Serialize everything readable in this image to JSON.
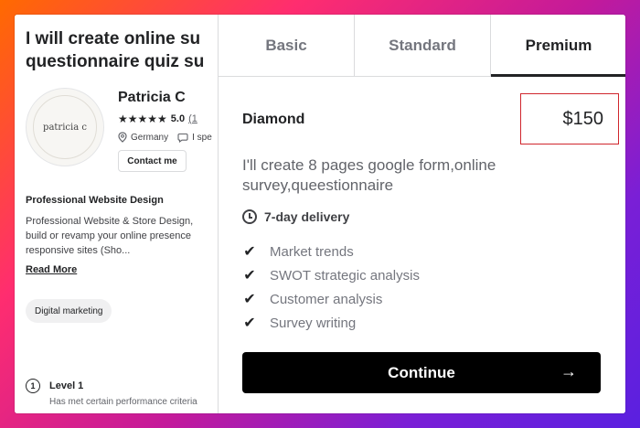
{
  "gig": {
    "title_line1": "I will create online su",
    "title_line2": "questionnaire quiz su"
  },
  "seller": {
    "avatar_text": "patricia c",
    "name": "Patricia C",
    "stars": "★★★★★",
    "rating": "5.0",
    "rating_count": "(1",
    "country": "Germany",
    "languages": "I spe",
    "contact_label": "Contact me"
  },
  "about": {
    "title": "Professional Website Design",
    "desc_line1": "Professional Website & Store Design,",
    "desc_line2": "build or revamp your online presence",
    "desc_line3": "responsive sites (Sho...",
    "read_more": "Read More"
  },
  "tag": "Digital marketing",
  "level": {
    "icon": "1",
    "title": "Level 1",
    "desc": "Has met certain performance criteria"
  },
  "tabs": [
    {
      "label": "Basic",
      "active": false
    },
    {
      "label": "Standard",
      "active": false
    },
    {
      "label": "Premium",
      "active": true
    }
  ],
  "package": {
    "name": "Diamond",
    "price": "$150",
    "desc_line1": "I'll create 8 pages google form,online",
    "desc_line2": "survey,queestionnaire",
    "delivery": "7-day delivery",
    "features": [
      "Market trends",
      "SWOT strategic analysis",
      "Customer analysis",
      "Survey writing"
    ],
    "continue_label": "Continue",
    "arrow": "→"
  },
  "colors": {
    "highlight_border": "#d0262d",
    "button_bg": "#000000"
  }
}
